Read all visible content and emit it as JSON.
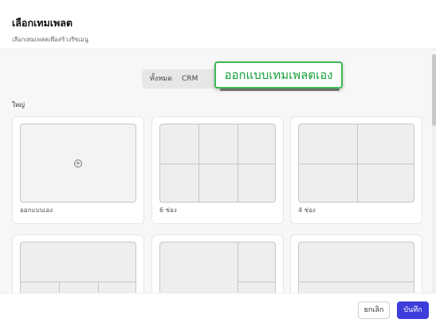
{
  "dialog": {
    "title": "เลือกเทมเพลต",
    "subtitle": "เลือกเทมเพลตเพื่อสร้างรีซเมนู"
  },
  "tabs": [
    {
      "label": "ทั้งหมด"
    },
    {
      "label": "CRM"
    }
  ],
  "tooltip": {
    "text": "ออกแบบเทมเพลตเอง"
  },
  "section": {
    "label": "ใหญ่"
  },
  "templates": [
    {
      "label": "ออกแบบเอง",
      "icon": "plus-circle-icon"
    },
    {
      "label": "6 ช่อง"
    },
    {
      "label": "4 ช่อง"
    },
    {
      "label": ""
    },
    {
      "label": ""
    },
    {
      "label": ""
    }
  ],
  "footer": {
    "cancel_label": "ยกเลิก",
    "save_label": "บันทึก"
  },
  "colors": {
    "accent": "#3d3ddb",
    "tooltip_border": "#3cba54",
    "tooltip_text": "#15a03a"
  }
}
